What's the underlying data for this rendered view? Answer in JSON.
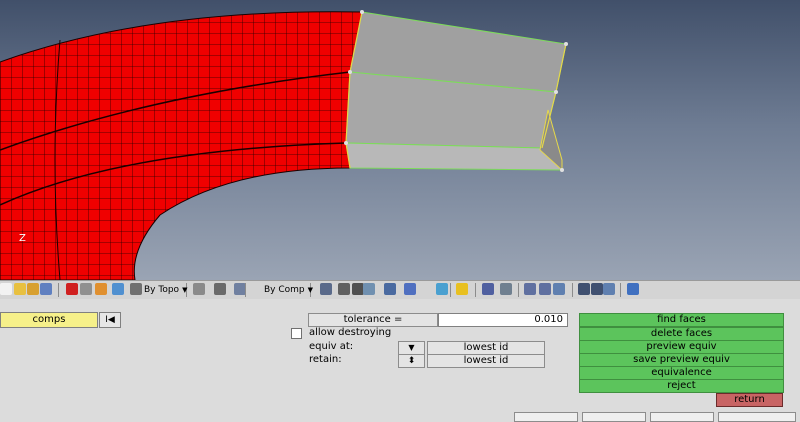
{
  "viewport": {
    "axis_label": "Z",
    "mesh_color": "#f00000",
    "surface_color": "#a0a0a0",
    "edge_color": "#7ddc5a"
  },
  "toolbar": {
    "select_topo": "By Topo",
    "select_comp": "By Comp",
    "icons": [
      "page-icon",
      "folder-icon",
      "open-icon",
      "save-icon",
      "delete-icon",
      "cube-icon",
      "import-icon",
      "tree-icon",
      "cursor-icon",
      "lasso-icon",
      "view-icon",
      "box-icon",
      "shade-icon",
      "wire-icon",
      "line-icon",
      "plane-icon",
      "solid-icon",
      "grid-icon",
      "screen-icon",
      "star-icon",
      "table-icon",
      "link-icon",
      "arrow-left-icon",
      "arrow-right-icon",
      "undo-icon",
      "minus-icon",
      "plus-icon",
      "redo-icon",
      "refresh-icon"
    ]
  },
  "panel": {
    "comps_label": "comps",
    "reset_glyph": "I◀",
    "tolerance_label": "tolerance =",
    "tolerance_value": "0.010",
    "allow_destroying_label": "allow destroying",
    "equiv_at_label": "equiv at:",
    "equiv_at_value": "lowest id",
    "retain_label": "retain:",
    "retain_value": "lowest id",
    "down_arrow": "▼",
    "updown_arrow": "⬍",
    "buttons": [
      "find faces",
      "delete faces",
      "preview equiv",
      "save preview equiv",
      "equivalence",
      "reject"
    ],
    "return_label": "return"
  }
}
